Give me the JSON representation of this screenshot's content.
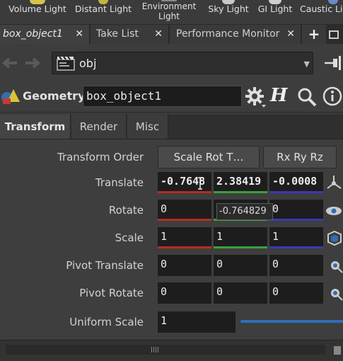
{
  "shelf": {
    "tools": [
      {
        "label": "Volume Light"
      },
      {
        "label": "Distant Light"
      },
      {
        "label_line1": "Environment",
        "label_line2": "Light"
      },
      {
        "label": "Sky Light"
      },
      {
        "label": "GI Light"
      },
      {
        "label": "Caustic Li"
      }
    ]
  },
  "tabs": [
    {
      "label": "box_object1"
    },
    {
      "label": "Take List"
    },
    {
      "label": "Performance Monitor"
    }
  ],
  "nav": {
    "path": "obj"
  },
  "header": {
    "type_label": "Geometry",
    "node_name": "box_object1"
  },
  "param_tabs": [
    {
      "label": "Transform"
    },
    {
      "label": "Render"
    },
    {
      "label": "Misc"
    }
  ],
  "params": {
    "transform_order": {
      "label": "Transform Order",
      "value1": "Scale Rot T…",
      "value2": "Rx Ry Rz"
    },
    "translate": {
      "label": "Translate",
      "x": "-0.7648",
      "y": "2.38419",
      "z": "-0.0008"
    },
    "rotate": {
      "label": "Rotate",
      "x": "0",
      "y": "0",
      "z": "0"
    },
    "scale": {
      "label": "Scale",
      "x": "1",
      "y": "1",
      "z": "1"
    },
    "pivot_translate": {
      "label": "Pivot Translate",
      "x": "0",
      "y": "0",
      "z": "0"
    },
    "pivot_rotate": {
      "label": "Pivot Rotate",
      "x": "0",
      "y": "0",
      "z": "0"
    },
    "uniform_scale": {
      "label": "Uniform Scale",
      "value": "1"
    }
  },
  "tooltip": {
    "text": "-0.764829"
  },
  "colors": {
    "x_axis": "#b82c22",
    "y_axis": "#3aa13a",
    "z_axis": "#3c38b8",
    "accent": "#2f6fb8"
  }
}
